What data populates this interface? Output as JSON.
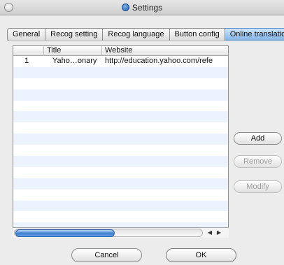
{
  "window": {
    "title": "Settings"
  },
  "tabs": [
    "General",
    "Recog setting",
    "Recog language",
    "Button config",
    "Online translation"
  ],
  "active_tab_index": 4,
  "table": {
    "columns": [
      "",
      "Title",
      "Website"
    ],
    "rows": [
      {
        "num": "1",
        "title": "Yaho…onary",
        "website": "http://education.yahoo.com/refe"
      }
    ]
  },
  "buttons": {
    "add": "Add",
    "remove": "Remove",
    "modify": "Modify",
    "cancel": "Cancel",
    "ok": "OK"
  }
}
